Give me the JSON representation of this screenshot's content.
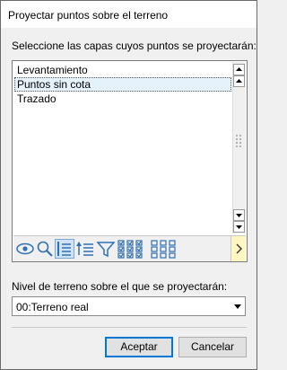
{
  "window": {
    "title": "Proyectar puntos sobre el terreno"
  },
  "layers": {
    "prompt": "Seleccione las capas cuyos puntos se proyectarán:",
    "items": [
      {
        "label": "Levantamiento",
        "selected": false
      },
      {
        "label": "Puntos sin cota",
        "selected": true
      },
      {
        "label": "Trazado",
        "selected": false
      }
    ],
    "toolbar_icons": [
      "eye-icon",
      "search-icon",
      "sort-list-icon",
      "sort-ascending-icon",
      "filter-icon",
      "check-all-icon",
      "uncheck-all-icon",
      "chevron-right-icon"
    ]
  },
  "level": {
    "label": "Nivel de terreno sobre el que se proyectarán:",
    "selected": "00:Terreno real"
  },
  "buttons": {
    "accept": "Aceptar",
    "cancel": "Cancelar"
  },
  "colors": {
    "selection": "#e5f1fb",
    "default_button_border": "#0078d7",
    "more_button": "#fff7c2"
  }
}
